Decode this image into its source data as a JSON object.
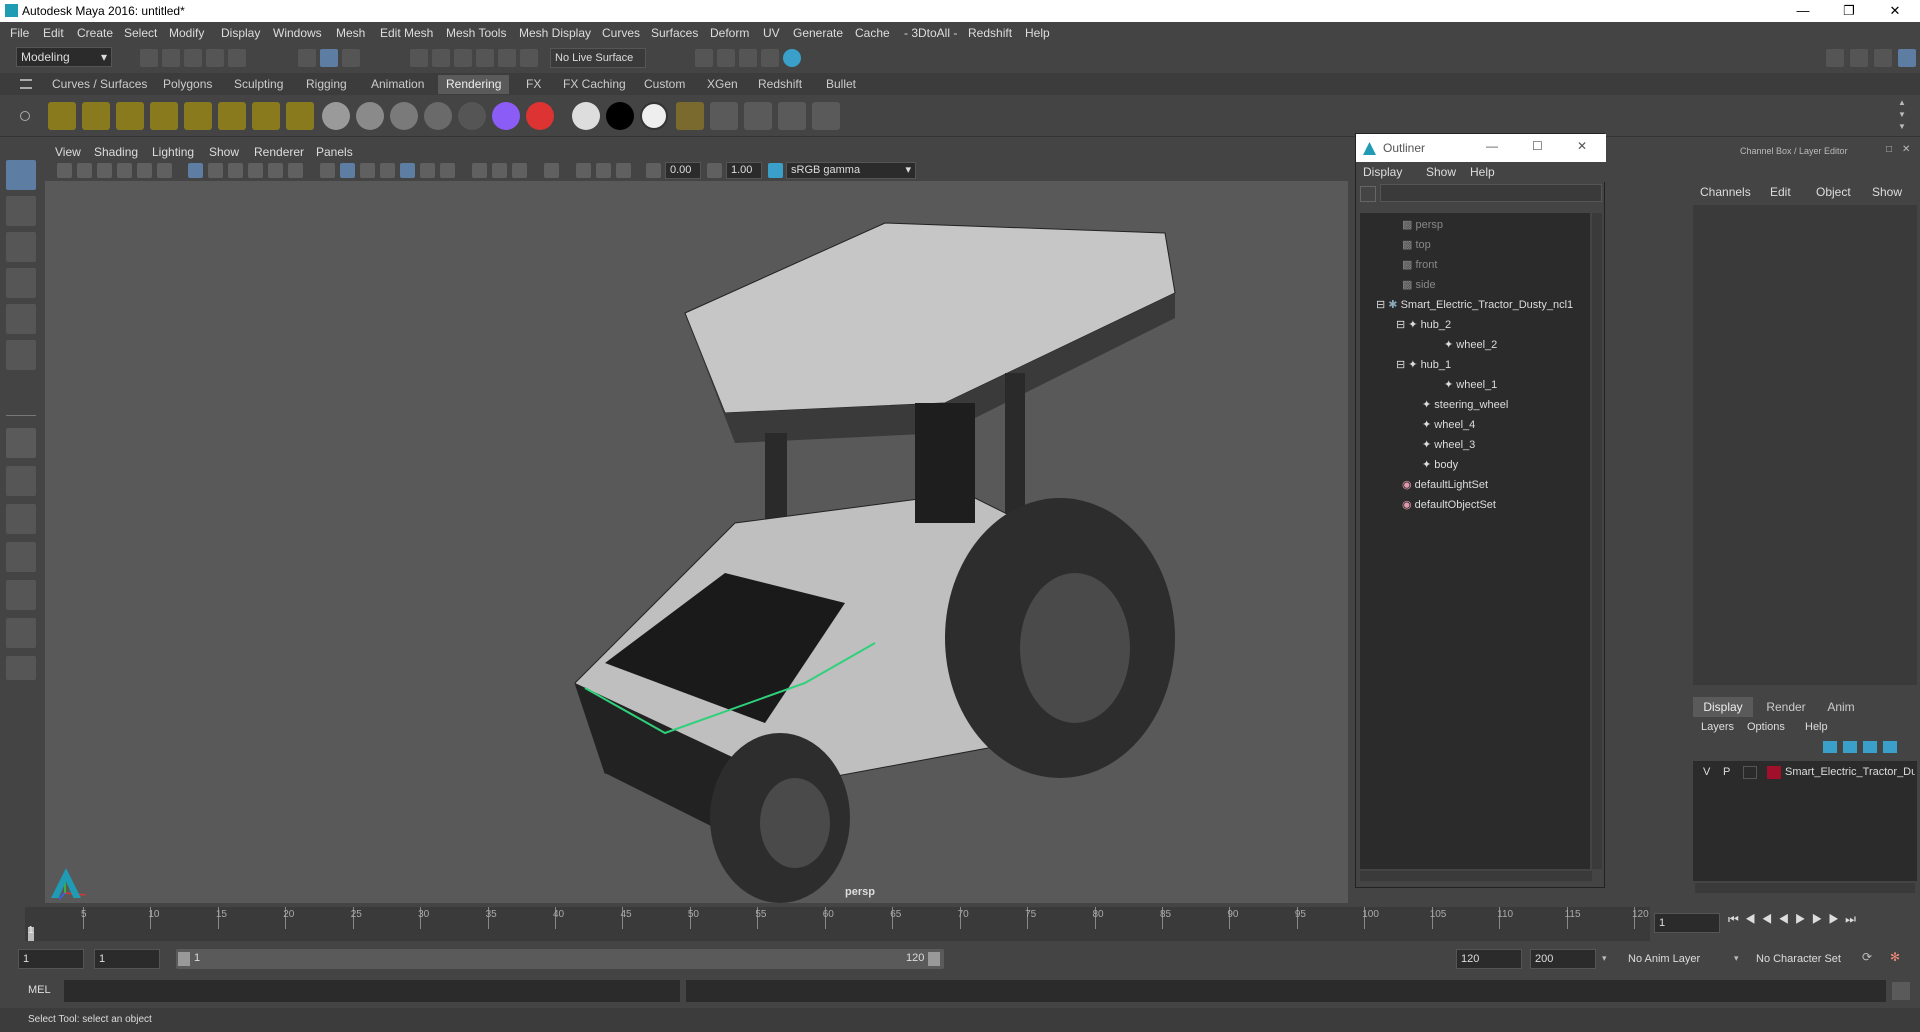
{
  "app": {
    "title": "Autodesk Maya 2016: untitled*"
  },
  "menubar": [
    "File",
    "Edit",
    "Create",
    "Select",
    "Modify",
    "Display",
    "Windows",
    "Mesh",
    "Edit Mesh",
    "Mesh Tools",
    "Mesh Display",
    "Curves",
    "Surfaces",
    "Deform",
    "UV",
    "Generate",
    "Cache",
    "- 3DtoAll -",
    "Redshift",
    "Help"
  ],
  "toolbar": {
    "mode": "Modeling",
    "live_surface": "No Live Surface"
  },
  "shelf_tabs": [
    "Curves / Surfaces",
    "Polygons",
    "Sculpting",
    "Rigging",
    "Animation",
    "Rendering",
    "FX",
    "FX Caching",
    "Custom",
    "XGen",
    "Redshift",
    "Bullet"
  ],
  "shelf_active": "Rendering",
  "viewport": {
    "menu": [
      "View",
      "Shading",
      "Lighting",
      "Show",
      "Renderer",
      "Panels"
    ],
    "exposure": "0.00",
    "gamma": "1.00",
    "colorspace": "sRGB gamma",
    "camera_label": "persp"
  },
  "outliner": {
    "title": "Outliner",
    "menu": [
      "Display",
      "Show",
      "Help"
    ],
    "items": [
      "persp",
      "top",
      "front",
      "side",
      "Smart_Electric_Tractor_Dusty_ncl1",
      "hub_2",
      "wheel_2",
      "hub_1",
      "wheel_1",
      "steering_wheel",
      "wheel_4",
      "wheel_3",
      "body",
      "defaultLightSet",
      "defaultObjectSet"
    ]
  },
  "channelbox": {
    "title": "Channel Box / Layer Editor",
    "menu": [
      "Channels",
      "Edit",
      "Object",
      "Show"
    ],
    "layer_tabs": [
      "Display",
      "Render",
      "Anim"
    ],
    "layer_tab_active": "Display",
    "layer_menu": [
      "Layers",
      "Options",
      "Help"
    ],
    "layer": {
      "v": "V",
      "p": "P",
      "name": "Smart_Electric_Tractor_Du",
      "color": "#a0102a"
    }
  },
  "timeline": {
    "ticks": [
      "5",
      "10",
      "15",
      "20",
      "25",
      "30",
      "35",
      "40",
      "45",
      "50",
      "55",
      "60",
      "65",
      "70",
      "75",
      "80",
      "85",
      "90",
      "95",
      "100",
      "105",
      "110",
      "115",
      "120"
    ],
    "start_marker": "1",
    "current_frame": "1"
  },
  "range": {
    "start": "1",
    "anim_start": "1",
    "slider_start": "1",
    "slider_end": "120",
    "anim_end": "120",
    "end": "200",
    "anim_layer": "No Anim Layer",
    "character_set": "No Character Set"
  },
  "cmdline": {
    "label": "MEL"
  },
  "status": {
    "text": "Select Tool: select an object"
  }
}
